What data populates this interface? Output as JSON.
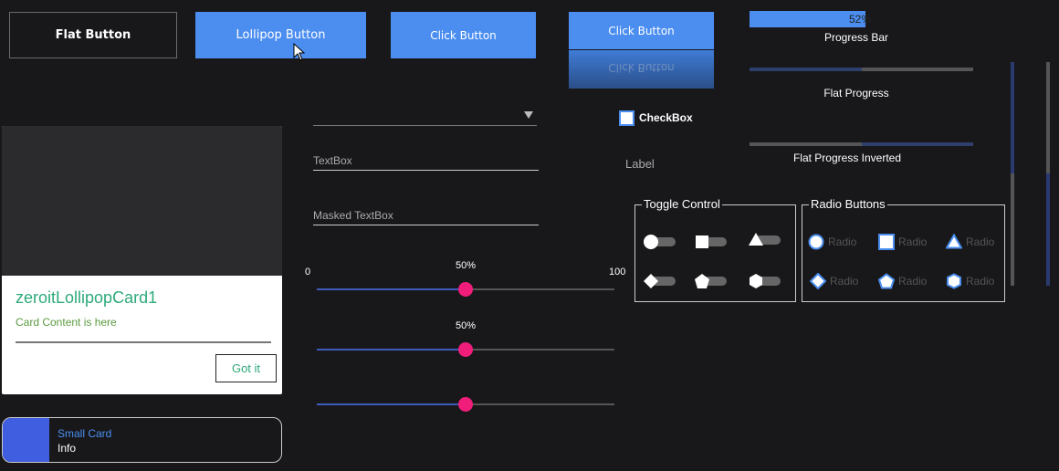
{
  "buttons": {
    "flat": "Flat Button",
    "lollipop": "Lollipop Button",
    "click1": "Click Button",
    "click2": "Click Button",
    "click2_reflection": "Click Button"
  },
  "progress": {
    "bar_value_text": "52%",
    "bar_value": 52,
    "bar_label": "Progress Bar",
    "flat_label": "Flat Progress",
    "flat_value": 50,
    "flat_inverted_label": "Flat Progress Inverted",
    "flat_inverted_value": 50
  },
  "inputs": {
    "textbox": "TextBox",
    "masked_textbox": "Masked TextBox"
  },
  "checkbox": {
    "label": "CheckBox",
    "checked": false
  },
  "label": {
    "text": "Label"
  },
  "card": {
    "title": "zeroitLollipopCard1",
    "content": "Card Content is here",
    "button": "Got it"
  },
  "small_card": {
    "title": "Small Card",
    "info": "Info",
    "accent_color": "#3f5ee0"
  },
  "sliders": {
    "min_label": "0",
    "max_label": "100",
    "items": [
      {
        "value": 50,
        "value_text": "50%"
      },
      {
        "value": 50,
        "value_text": "50%"
      },
      {
        "value": 50,
        "value_text": ""
      }
    ]
  },
  "toggle_group": {
    "title": "Toggle Control",
    "items": [
      {
        "shape": "circle"
      },
      {
        "shape": "square"
      },
      {
        "shape": "triangle"
      },
      {
        "shape": "diamond"
      },
      {
        "shape": "pentagon"
      },
      {
        "shape": "hexagon"
      }
    ]
  },
  "radio_group": {
    "title": "Radio Buttons",
    "items": [
      {
        "label": "Radio",
        "shape": "circle"
      },
      {
        "label": "Radio",
        "shape": "square"
      },
      {
        "label": "Radio",
        "shape": "triangle"
      },
      {
        "label": "Radio",
        "shape": "diamond"
      },
      {
        "label": "Radio",
        "shape": "pentagon"
      },
      {
        "label": "Radio",
        "shape": "hexagon"
      }
    ]
  },
  "colors": {
    "accent": "#4b8ef0",
    "slider_knob": "#f01d7a",
    "card_title": "#2eaa7a",
    "background": "#18181b"
  }
}
